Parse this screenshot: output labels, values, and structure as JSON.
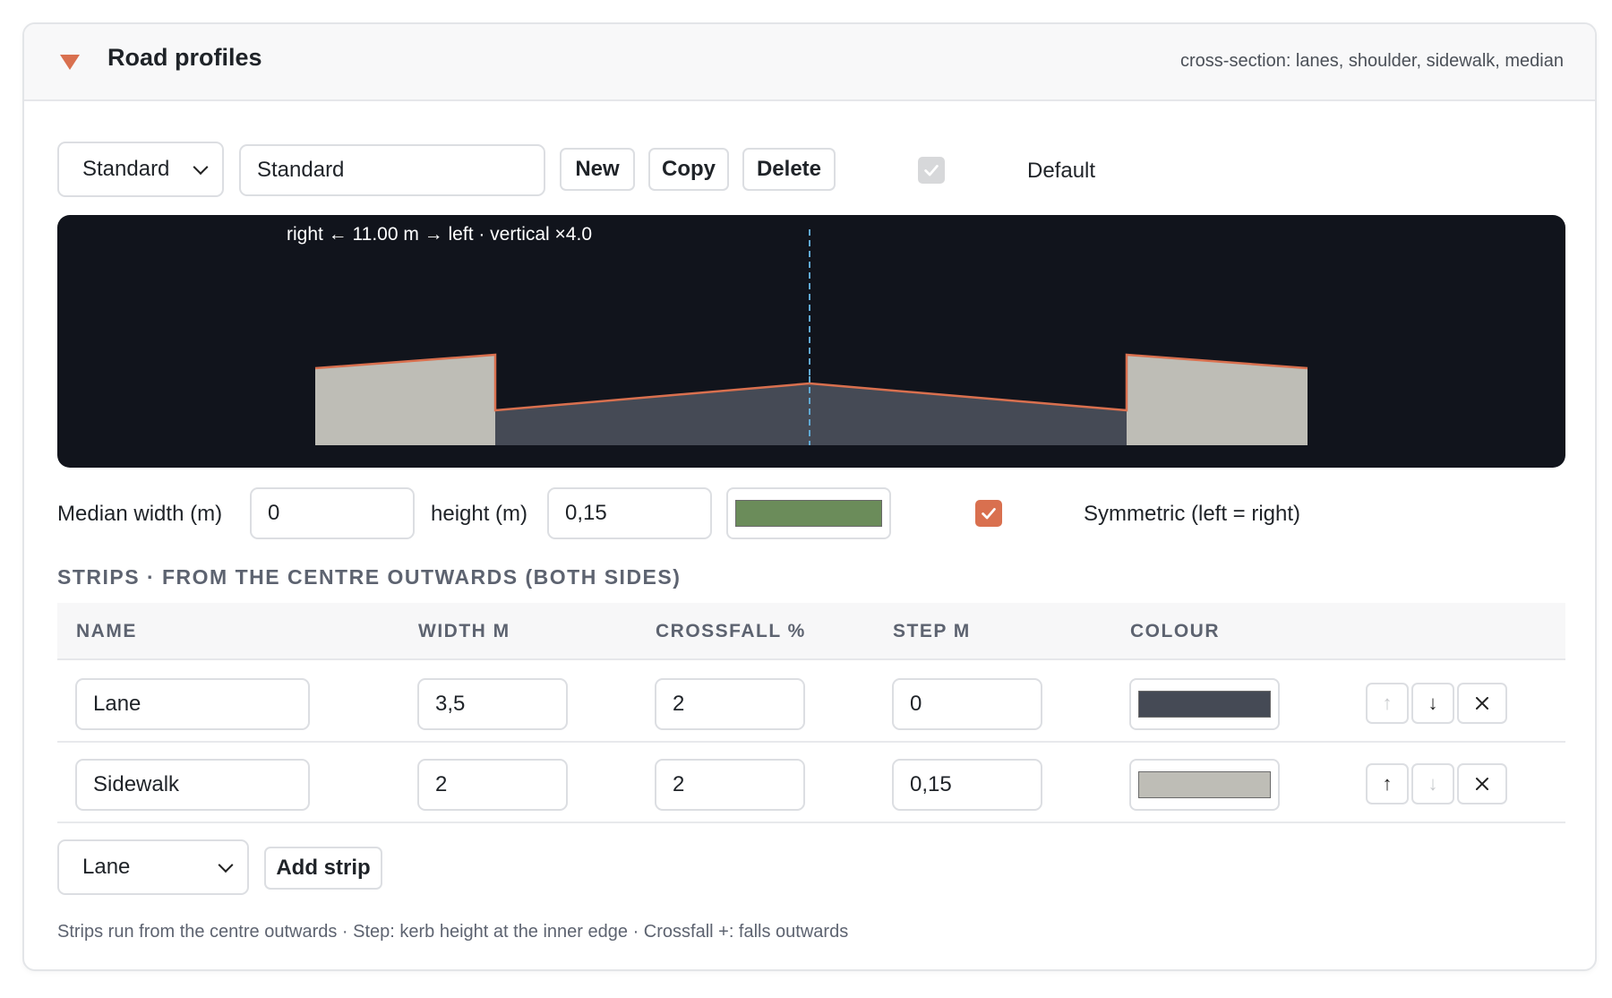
{
  "header": {
    "title": "Road profiles",
    "subtitle": "cross-section: lanes, shoulder, sidewalk, median"
  },
  "toolbar": {
    "profile_select": "Standard",
    "profile_name": "Standard",
    "new_label": "New",
    "copy_label": "Copy",
    "delete_label": "Delete",
    "default_label": "Default",
    "default_checked": true
  },
  "preview": {
    "caption": "right ← 11.00 m → left · vertical ×4.0"
  },
  "median": {
    "width_label": "Median width (m)",
    "width_value": "0",
    "height_label": "height (m)",
    "height_value": "0,15",
    "colour": "#6b8c5a",
    "symmetric_label": "Symmetric (left = right)",
    "symmetric_checked": true
  },
  "strips": {
    "section_title": "STRIPS · FROM THE CENTRE OUTWARDS (BOTH SIDES)",
    "columns": [
      "NAME",
      "WIDTH M",
      "CROSSFALL %",
      "STEP M",
      "COLOUR"
    ],
    "rows": [
      {
        "name": "Lane",
        "width": "3,5",
        "crossfall": "2",
        "step": "0",
        "colour": "#454a55"
      },
      {
        "name": "Sidewalk",
        "width": "2",
        "crossfall": "2",
        "step": "0,15",
        "colour": "#bebdb6"
      }
    ],
    "add_select": "Lane",
    "add_label": "Add strip",
    "footnote": "Strips run from the centre outwards · Step: kerb height at the inner edge · Crossfall +: falls outwards"
  },
  "colors": {
    "accent": "#d9704f",
    "canvas_bg": "#11141c",
    "lane": "#454a55",
    "sidewalk": "#bebdb6",
    "centerline": "#5fa8d3"
  }
}
